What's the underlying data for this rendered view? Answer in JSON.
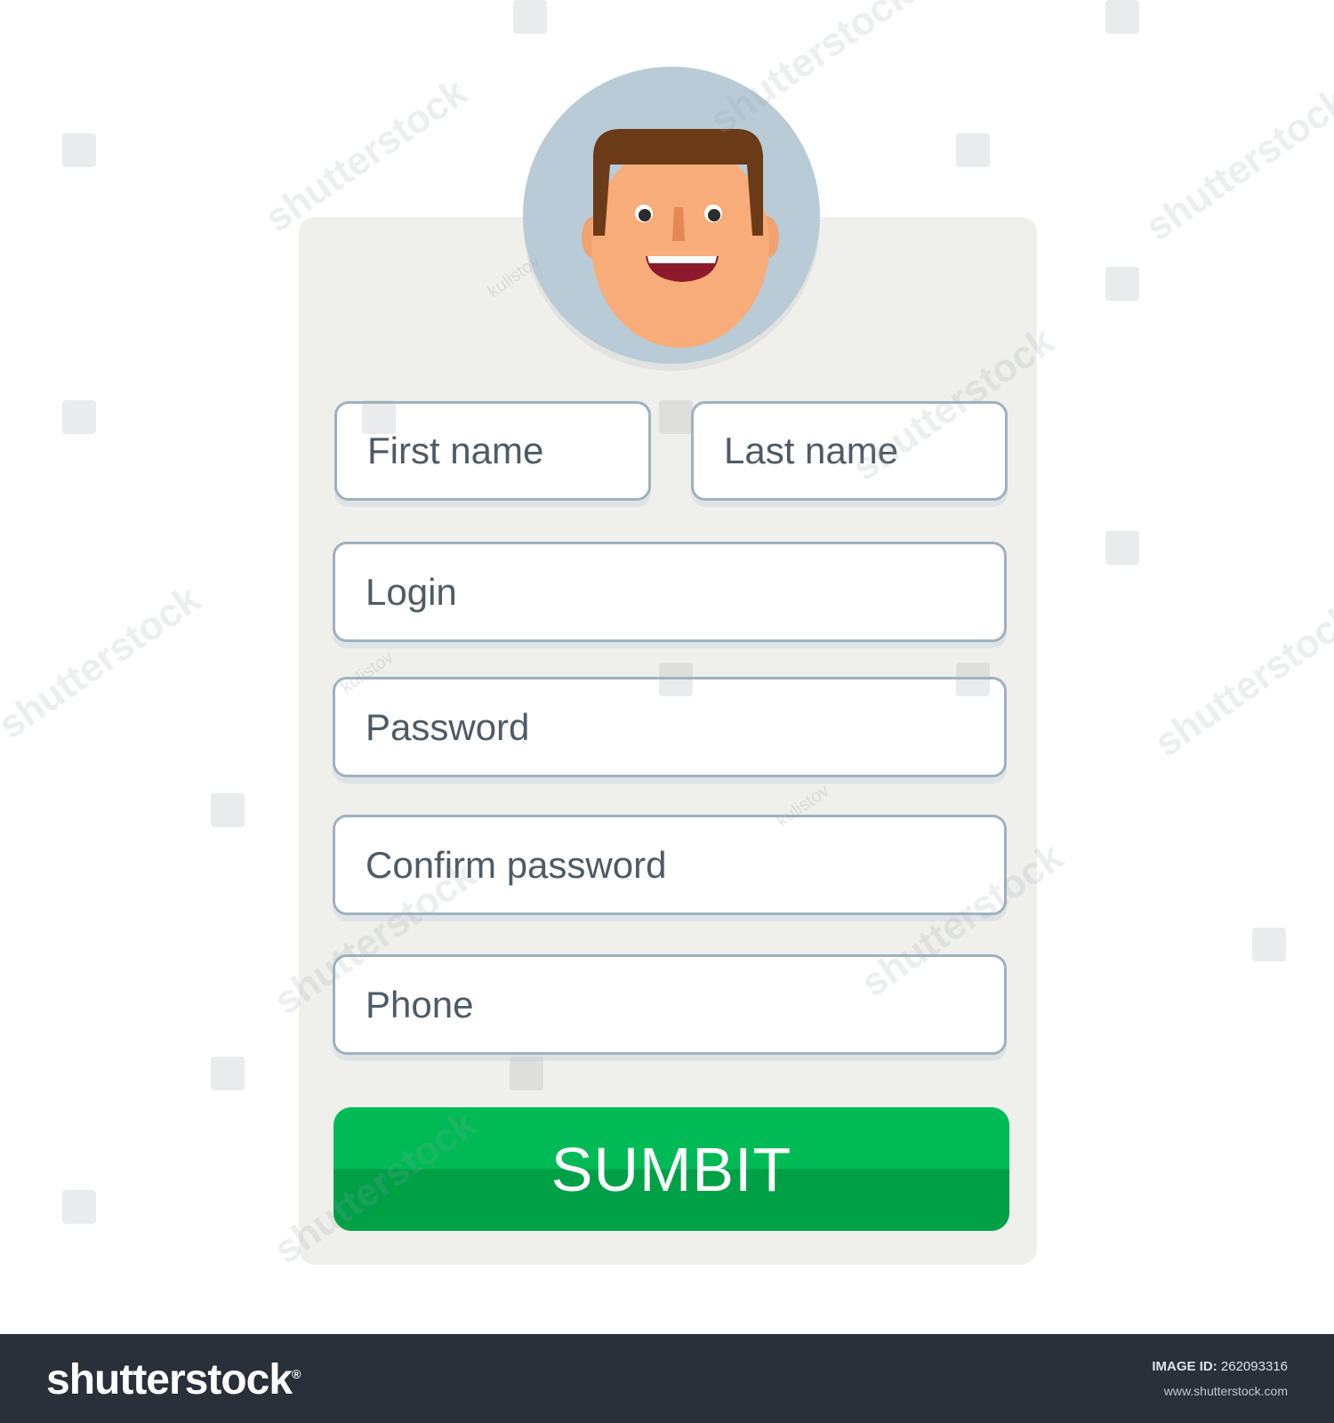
{
  "form": {
    "first_name_placeholder": "First name",
    "last_name_placeholder": "Last name",
    "login_placeholder": "Login",
    "password_placeholder": "Password",
    "confirm_password_placeholder": "Confirm password",
    "phone_placeholder": "Phone",
    "submit_label": "SUMBIT"
  },
  "watermark": {
    "brand": "shutterstock",
    "author": "kulistov"
  },
  "footer": {
    "brand": "shutterstock",
    "image_id_label": "IMAGE ID:",
    "image_id": "262093316",
    "site": "www.shutterstock.com"
  },
  "colors": {
    "card_background": "#efefeb",
    "avatar_background": "#b8cbd6",
    "field_border": "#9db2c0",
    "submit_green": "#00bb55",
    "footer_background": "#29303a"
  }
}
